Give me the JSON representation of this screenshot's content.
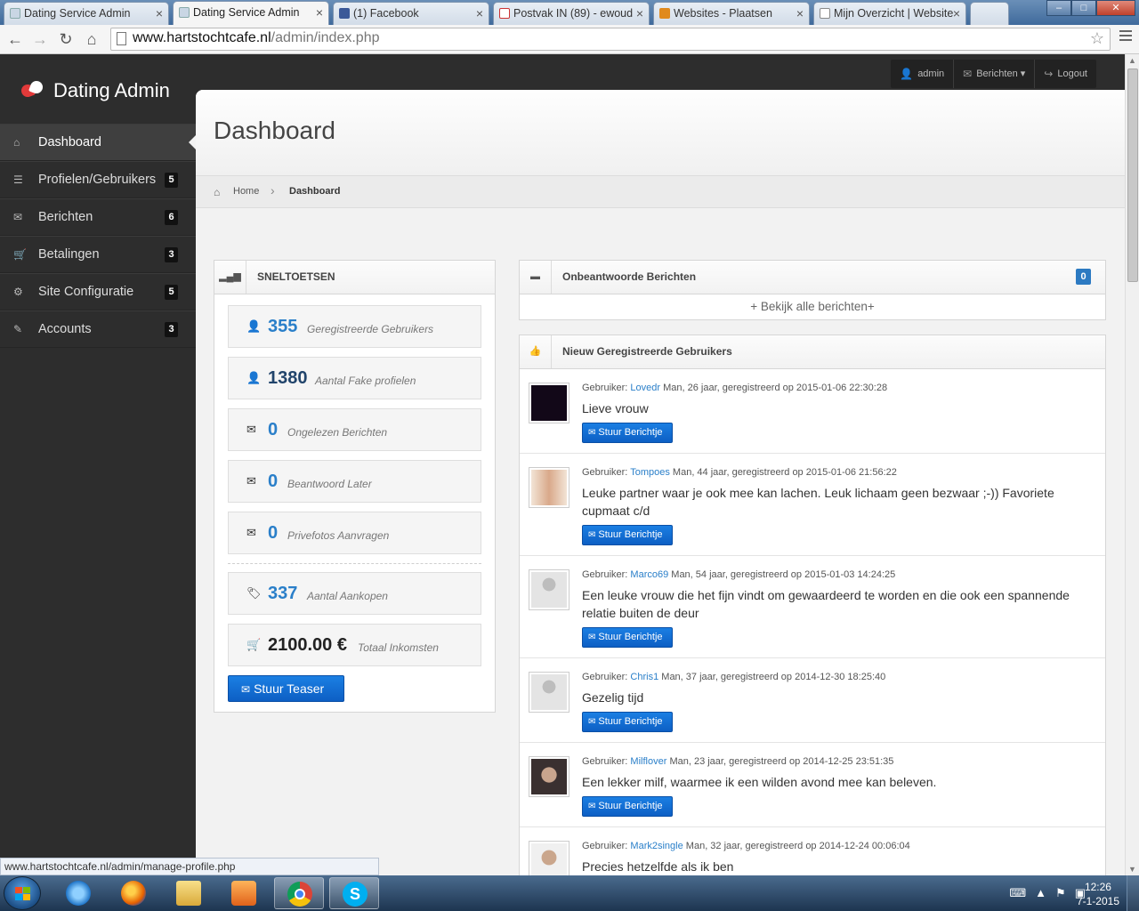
{
  "browser": {
    "tabs": [
      {
        "title": "Dating Service Admin",
        "active": false
      },
      {
        "title": "Dating Service Admin",
        "active": true
      },
      {
        "title": "(1) Facebook",
        "active": false
      },
      {
        "title": "Postvak IN (89) - ewoud",
        "active": false
      },
      {
        "title": "Websites - Plaatsen",
        "active": false
      },
      {
        "title": "Mijn Overzicht | Website",
        "active": false
      }
    ],
    "tab_close": "×",
    "url_host": "www.hartstochtcafe.nl",
    "url_path": "/admin/index.php",
    "status_url": "www.hartstochtcafe.nl/admin/manage-profile.php"
  },
  "app": {
    "brand": "Dating Admin",
    "topnav": [
      {
        "icon": "user-icon",
        "glyph": "👤",
        "label": "admin"
      },
      {
        "icon": "envelope-icon",
        "glyph": "✉",
        "label": "Berichten ▾"
      },
      {
        "icon": "logout-icon",
        "glyph": "↪",
        "label": "Logout"
      }
    ]
  },
  "sidebar": {
    "items": [
      {
        "label": "Dashboard",
        "glyph": "⌂",
        "badge": "",
        "active": true
      },
      {
        "label": "Profielen/Gebruikers",
        "glyph": "☰",
        "badge": "5",
        "active": false
      },
      {
        "label": "Berichten",
        "glyph": "✉",
        "badge": "6",
        "active": false
      },
      {
        "label": "Betalingen",
        "glyph": "🛒",
        "badge": "3",
        "active": false
      },
      {
        "label": "Site Configuratie",
        "glyph": "⚙",
        "badge": "5",
        "active": false
      },
      {
        "label": "Accounts",
        "glyph": "✎",
        "badge": "3",
        "active": false
      }
    ]
  },
  "page": {
    "title": "Dashboard",
    "breadcrumb_home": "Home",
    "breadcrumb_sep": "›",
    "breadcrumb_current": "Dashboard"
  },
  "sneltoetsen": {
    "title": "SNELTOETSEN",
    "stats": [
      {
        "icon": "user-icon",
        "glyph": "👤",
        "value": "355",
        "label": "Geregistreerde Gebruikers"
      },
      {
        "icon": "user-icon",
        "glyph": "👤",
        "value": "1380",
        "label": "Aantal Fake profielen"
      },
      {
        "icon": "envelope-icon",
        "glyph": "✉",
        "value": "0",
        "label": "Ongelezen Berichten"
      },
      {
        "icon": "envelope-icon",
        "glyph": "✉",
        "value": "0",
        "label": "Beantwoord Later"
      },
      {
        "icon": "envelope-icon",
        "glyph": "✉",
        "value": "0",
        "label": "Privefotos Aanvragen"
      },
      {
        "icon": "tags-icon",
        "glyph": "🏷",
        "value": "337",
        "label": "Aantal Aankopen"
      },
      {
        "icon": "cart-icon",
        "glyph": "🛒",
        "value": "2100.00 €",
        "label": "Totaal Inkomsten"
      }
    ],
    "teaser_button": "Stuur Teaser"
  },
  "unanswered": {
    "title": "Onbeantwoorde Berichten",
    "count": "0",
    "view_all": "+ Bekijk alle berichten+"
  },
  "new_users": {
    "title": "Nieuw Geregistreerde Gebruikers",
    "user_prefix": "Gebruiker:",
    "button_label": "Stuur Berichtje",
    "users": [
      {
        "name": "Lovedr",
        "meta": "Man, 26 jaar, geregistreerd op 2015-01-06 22:30:28",
        "text": "Lieve vrouw",
        "avatar_color": "#120818"
      },
      {
        "name": "Tompoes",
        "meta": "Man, 44 jaar, geregistreerd op 2015-01-06 21:56:22",
        "text": "Leuke partner waar je ook mee kan lachen. Leuk lichaam geen bezwaar ;-)) Favoriete cupmaat c/d",
        "avatar_color": "#d9a98a"
      },
      {
        "name": "Marco69",
        "meta": "Man, 54 jaar, geregistreerd op 2015-01-03 14:24:25",
        "text": "Een leuke vrouw die het fijn vindt om gewaardeerd te worden en die ook een spannende relatie buiten de deur",
        "avatar_color": "#d8d8d8"
      },
      {
        "name": "Chris1",
        "meta": "Man, 37 jaar, geregistreerd op 2014-12-30 18:25:40",
        "text": "Gezelig tijd",
        "avatar_color": "#d8d8d8"
      },
      {
        "name": "Milflover",
        "meta": "Man, 23 jaar, geregistreerd op 2014-12-25 23:51:35",
        "text": "Een lekker milf, waarmee ik een wilden avond mee kan beleven.",
        "avatar_color": "#5a4a44"
      },
      {
        "name": "Mark2single",
        "meta": "Man, 32 jaar, geregistreerd op 2014-12-24 00:06:04",
        "text": "Precies hetzelfde als ik ben",
        "avatar_color": "#2a2624"
      }
    ]
  },
  "taskbar": {
    "apps": [
      "internet-explorer",
      "firefox",
      "file-explorer",
      "media-player",
      "chrome",
      "skype"
    ],
    "clock_time": "12:26",
    "clock_date": "7-1-2015"
  }
}
